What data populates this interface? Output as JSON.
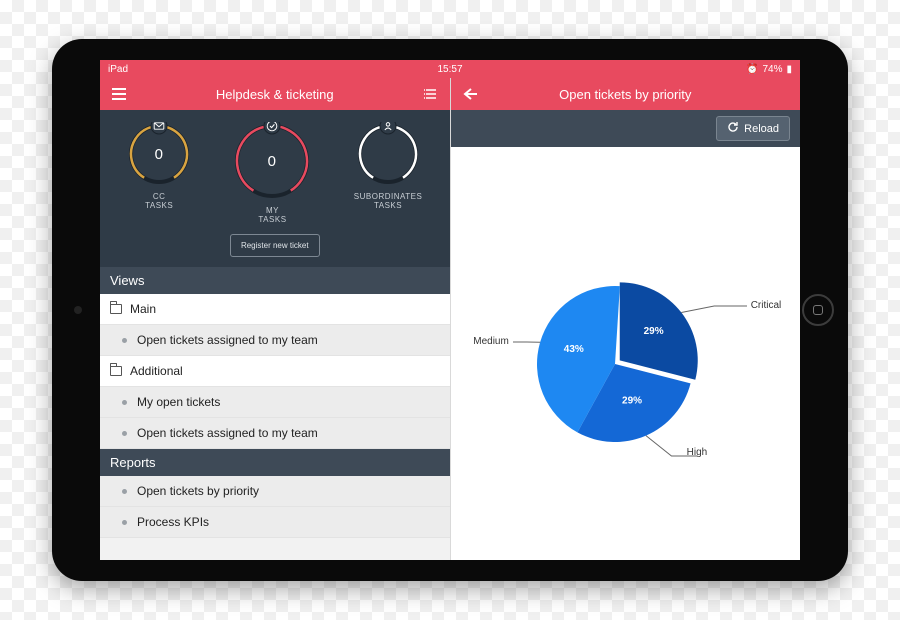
{
  "statusbar": {
    "carrier": "iPad",
    "time": "15:57",
    "battery": "74%",
    "wifi_icon": "wifi-icon",
    "alarm_icon": "alarm-icon"
  },
  "left_nav": {
    "title": "Helpdesk & ticketing",
    "menu_icon": "menu-icon",
    "list_icon": "list-icon"
  },
  "right_nav": {
    "title": "Open tickets by priority",
    "back_icon": "back-icon"
  },
  "dash": {
    "gauges": [
      {
        "value": "0",
        "label": "CC TASKS",
        "color": "#d9a441",
        "icon": "envelope"
      },
      {
        "value": "0",
        "label": "MY TASKS",
        "color": "#e84a5f",
        "icon": "check"
      },
      {
        "value": "",
        "label": "SUBORDINATES TASKS",
        "color": "#ffffff",
        "icon": "person"
      }
    ],
    "register_label": "Register new ticket"
  },
  "sections": {
    "views_label": "Views",
    "reports_label": "Reports",
    "groups": [
      {
        "label": "Main",
        "items": [
          "Open tickets assigned to my team"
        ]
      },
      {
        "label": "Additional",
        "items": [
          "My open tickets",
          "Open tickets assigned to my team"
        ]
      }
    ],
    "reports": [
      "Open tickets by priority",
      "Process KPIs"
    ]
  },
  "toolbar": {
    "reload_label": "Reload"
  },
  "chart_data": {
    "type": "pie",
    "title": "Open tickets by priority",
    "series": [
      {
        "name": "Critical",
        "value": 29,
        "label": "29%",
        "color": "#0b4aa2"
      },
      {
        "name": "High",
        "value": 29,
        "label": "29%",
        "color": "#1468d6"
      },
      {
        "name": "Medium",
        "value": 43,
        "label": "43%",
        "color": "#1e88f2"
      }
    ]
  }
}
